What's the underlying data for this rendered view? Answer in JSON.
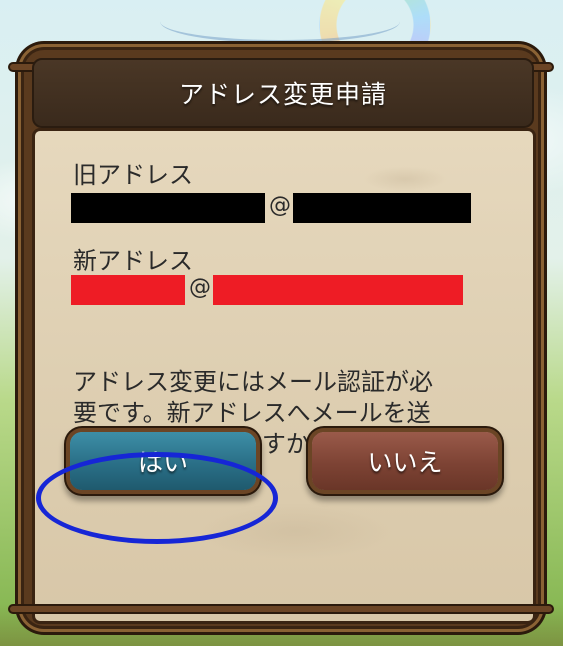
{
  "dialog": {
    "title": "アドレス変更申請",
    "old_address_label": "旧アドレス",
    "new_address_label": "新アドレス",
    "at_symbol": "@",
    "message_lines": [
      "アドレス変更にはメール認証が必",
      "要です。新アドレスへメールを送",
      "ってもよろしいですか？"
    ],
    "yes_label": "はい",
    "no_label": "いいえ"
  },
  "colors": {
    "old_redaction": "#000000",
    "new_redaction": "#ee1c25",
    "highlight_ring": "#1626d6",
    "yes_button": "#2a6f87",
    "no_button": "#7d4334"
  }
}
